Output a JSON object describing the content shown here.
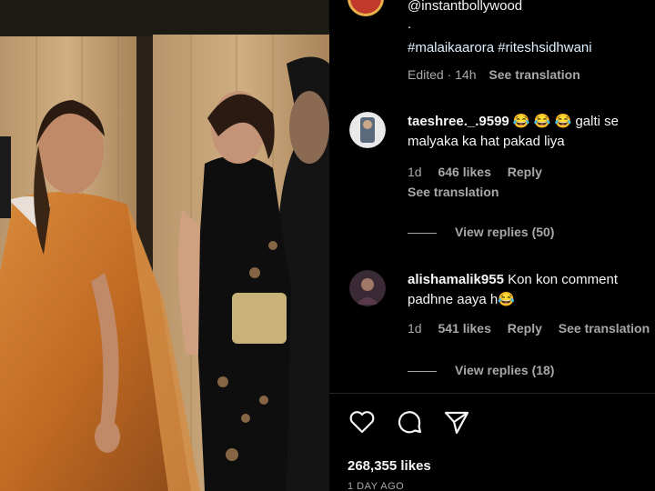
{
  "post": {
    "username": "@instantbollywood",
    "dot": ".",
    "hashtags": "#malaikaarora #riteshsidhwani",
    "edited": "Edited · 14h",
    "see_translation": "See translation"
  },
  "comments": [
    {
      "username": "taeshree._.9599",
      "text": " 😂 😂 😂 galti se malyaka ka hat pakad liya",
      "age": "1d",
      "likes": "646 likes",
      "reply": "Reply",
      "see_translation": "See translation",
      "view_replies": "View replies (50)"
    },
    {
      "username": "alishamalik955",
      "text": " Kon kon comment padhne aaya h😂",
      "age": "1d",
      "likes": "541 likes",
      "reply": "Reply",
      "see_translation": "See translation",
      "view_replies": "View replies (18)"
    }
  ],
  "actions": {
    "icons": [
      "heart-icon",
      "comment-icon",
      "share-icon"
    ]
  },
  "footer": {
    "likes": "268,355 likes",
    "ago": "1 DAY AGO"
  },
  "colors": {
    "background": "#000000",
    "text_primary": "#f5f5f5",
    "text_secondary": "#a8a8a8",
    "hashtag": "#e0f1ff"
  }
}
